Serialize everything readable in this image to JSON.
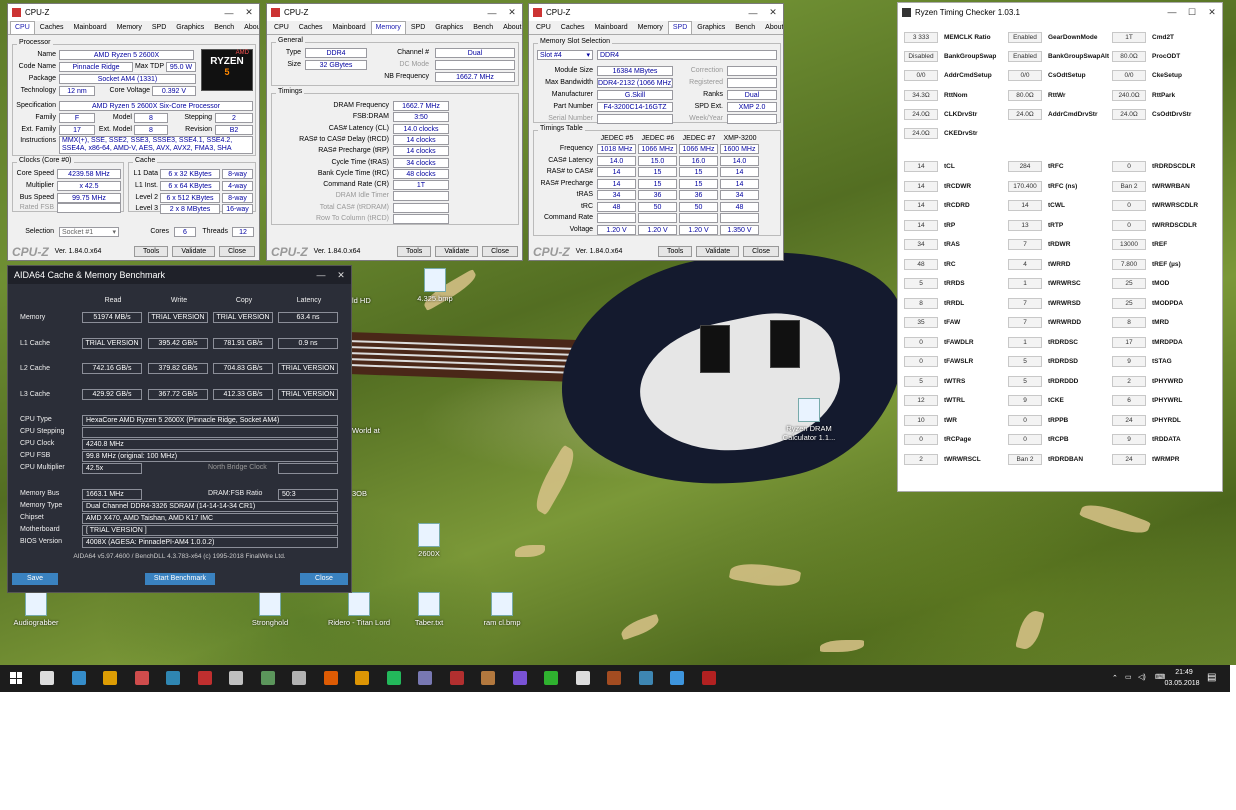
{
  "cpuz1": {
    "title": "CPU-Z",
    "tabs": [
      "CPU",
      "Caches",
      "Mainboard",
      "Memory",
      "SPD",
      "Graphics",
      "Bench",
      "About"
    ],
    "processor_grp": "Processor",
    "name_lbl": "Name",
    "name": "AMD Ryzen 5 2600X",
    "code_lbl": "Code Name",
    "code": "Pinnacle Ridge",
    "tdp_lbl": "Max TDP",
    "tdp": "95.0 W",
    "pkg_lbl": "Package",
    "pkg": "Socket AM4 (1331)",
    "tech_lbl": "Technology",
    "tech": "12 nm",
    "volt_lbl": "Core Voltage",
    "volt": "0.392 V",
    "spec_lbl": "Specification",
    "spec": "AMD Ryzen 5 2600X Six-Core Processor",
    "fam_lbl": "Family",
    "fam": "F",
    "model_lbl": "Model",
    "model": "8",
    "step_lbl": "Stepping",
    "step": "2",
    "efam_lbl": "Ext. Family",
    "efam": "17",
    "emodel_lbl": "Ext. Model",
    "emodel": "8",
    "rev_lbl": "Revision",
    "rev": "B2",
    "instr_lbl": "Instructions",
    "instr": "MMX(+), SSE, SSE2, SSE3, SSSE3, SSE4.1, SSE4.2, SSE4A, x86-64, AMD-V, AES, AVX, AVX2, FMA3, SHA",
    "clocks_grp": "Clocks (Core #0)",
    "cs_lbl": "Core Speed",
    "cs": "4239.58 MHz",
    "mul_lbl": "Multiplier",
    "mul": "x 42.5",
    "bus_lbl": "Bus Speed",
    "bus": "99.75 MHz",
    "fsb_lbl": "Rated FSB",
    "cache_grp": "Cache",
    "l1d_lbl": "L1 Data",
    "l1d": "6 x 32 KBytes",
    "l1d_w": "8-way",
    "l1i_lbl": "L1 Inst.",
    "l1i": "6 x 64 KBytes",
    "l1i_w": "4-way",
    "l2_lbl": "Level 2",
    "l2": "6 x 512 KBytes",
    "l2_w": "8-way",
    "l3_lbl": "Level 3",
    "l3": "2 x 8 MBytes",
    "l3_w": "16-way",
    "sel_lbl": "Selection",
    "sel": "Socket #1",
    "cores_lbl": "Cores",
    "cores": "6",
    "threads_lbl": "Threads",
    "threads": "12",
    "logo_text": "RYZEN",
    "logo_num": "5",
    "footer_logo": "CPU-Z",
    "ver": "Ver. 1.84.0.x64",
    "tools": "Tools",
    "validate": "Validate",
    "close": "Close"
  },
  "cpuz2": {
    "title": "CPU-Z",
    "general_grp": "General",
    "type_lbl": "Type",
    "type": "DDR4",
    "ch_lbl": "Channel #",
    "ch": "Dual",
    "size_lbl": "Size",
    "size": "32 GBytes",
    "dc_lbl": "DC Mode",
    "nb_lbl": "NB Frequency",
    "nb": "1662.7 MHz",
    "timings_grp": "Timings",
    "t": [
      [
        "DRAM Frequency",
        "1662.7 MHz",
        false
      ],
      [
        "FSB:DRAM",
        "3:50",
        false
      ],
      [
        "CAS# Latency (CL)",
        "14.0 clocks",
        false
      ],
      [
        "RAS# to CAS# Delay (tRCD)",
        "14 clocks",
        false
      ],
      [
        "RAS# Precharge (tRP)",
        "14 clocks",
        false
      ],
      [
        "Cycle Time (tRAS)",
        "34 clocks",
        false
      ],
      [
        "Bank Cycle Time (tRC)",
        "48 clocks",
        false
      ],
      [
        "Command Rate (CR)",
        "1T",
        false
      ],
      [
        "DRAM Idle Timer",
        "",
        true
      ],
      [
        "Total CAS# (tRDRAM)",
        "",
        true
      ],
      [
        "Row To Column (tRCD)",
        "",
        true
      ]
    ]
  },
  "cpuz3": {
    "title": "CPU-Z",
    "slot_grp": "Memory Slot Selection",
    "slot": "Slot #4",
    "slot_type": "DDR4",
    "ms_lbl": "Module Size",
    "ms": "16384 MBytes",
    "corr_lbl": "Correction",
    "bw_lbl": "Max Bandwidth",
    "bw": "DDR4-2132 (1066 MHz)",
    "reg_lbl": "Registered",
    "man_lbl": "Manufacturer",
    "man": "G.Skill",
    "ranks_lbl": "Ranks",
    "ranks": "Dual",
    "pn_lbl": "Part Number",
    "pn": "F4-3200C14-16GTZ",
    "spd_lbl": "SPD Ext.",
    "spd": "XMP 2.0",
    "sn_lbl": "Serial Number",
    "wk_lbl": "Week/Year",
    "tt_grp": "Timings Table",
    "cols": [
      "JEDEC #5",
      "JEDEC #6",
      "JEDEC #7",
      "XMP-3200"
    ],
    "rows": [
      [
        "Frequency",
        "1018 MHz",
        "1066 MHz",
        "1066 MHz",
        "1600 MHz"
      ],
      [
        "CAS# Latency",
        "14.0",
        "15.0",
        "16.0",
        "14.0"
      ],
      [
        "RAS# to CAS#",
        "14",
        "15",
        "15",
        "14"
      ],
      [
        "RAS# Precharge",
        "14",
        "15",
        "15",
        "14"
      ],
      [
        "tRAS",
        "34",
        "36",
        "36",
        "34"
      ],
      [
        "tRC",
        "48",
        "50",
        "50",
        "48"
      ],
      [
        "Command Rate",
        "",
        "",
        "",
        ""
      ],
      [
        "Voltage",
        "1.20 V",
        "1.20 V",
        "1.20 V",
        "1.350 V"
      ]
    ]
  },
  "aida": {
    "title": "AIDA64 Cache & Memory Benchmark",
    "heads": [
      "Read",
      "Write",
      "Copy",
      "Latency"
    ],
    "bench": [
      [
        "Memory",
        "51974 MB/s",
        "TRIAL VERSION",
        "TRIAL VERSION",
        "63.4 ns"
      ],
      [
        "L1 Cache",
        "TRIAL VERSION",
        "395.42 GB/s",
        "781.91 GB/s",
        "0.9 ns"
      ],
      [
        "L2 Cache",
        "742.16 GB/s",
        "379.82 GB/s",
        "704.83 GB/s",
        "TRIAL VERSION"
      ],
      [
        "L3 Cache",
        "429.92 GB/s",
        "367.72 GB/s",
        "412.33 GB/s",
        "TRIAL VERSION"
      ]
    ],
    "info1": [
      [
        "CPU Type",
        "HexaCore AMD Ryzen 5 2600X (Pinnacle Ridge, Socket AM4)"
      ],
      [
        "CPU Stepping",
        ""
      ],
      [
        "CPU Clock",
        "4240.8 MHz"
      ],
      [
        "CPU FSB",
        "99.8 MHz (original: 100 MHz)"
      ]
    ],
    "mult_lbl": "CPU Multiplier",
    "mult": "42.5x",
    "nbclk_lbl": "North Bridge Clock",
    "membus_lbl": "Memory Bus",
    "membus": "1663.1 MHz",
    "ratio_lbl": "DRAM:FSB Ratio",
    "ratio": "50:3",
    "info2": [
      [
        "Memory Type",
        "Dual Channel DDR4-3326 SDRAM (14-14-14-34 CR1)"
      ],
      [
        "Chipset",
        "AMD X470, AMD Taishan, AMD K17 IMC"
      ],
      [
        "Motherboard",
        "[ TRIAL VERSION ]"
      ],
      [
        "BIOS Version",
        "4008X (AGESA: PinnaclePI-AM4 1.0.0.2)"
      ]
    ],
    "copyright": "AIDA64 v5.97.4600 / BenchDLL 4.3.783-x64 (c) 1995-2018 FinalWire Ltd.",
    "save": "Save",
    "start": "Start Benchmark",
    "close": "Close"
  },
  "rtc": {
    "title": "Ryzen Timing Checker 1.03.1",
    "top": [
      [
        "3 333",
        "MEMCLK Ratio",
        "Enabled",
        "GearDownMode",
        "1T",
        "Cmd2T"
      ],
      [
        "Disabled",
        "BankGroupSwap",
        "Enabled",
        "BankGroupSwapAlt",
        "80.0Ω",
        "ProcODT"
      ],
      [
        "0/0",
        "AddrCmdSetup",
        "0/0",
        "CsOdtSetup",
        "0/0",
        "CkeSetup"
      ],
      [
        "34.3Ω",
        "RttNom",
        "80.0Ω",
        "RttWr",
        "240.0Ω",
        "RttPark"
      ],
      [
        "24.0Ω",
        "CLKDrvStr",
        "24.0Ω",
        "AddrCmdDrvStr",
        "24.0Ω",
        "CsOdtDrvStr"
      ],
      [
        "24.0Ω",
        "CKEDrvStr",
        "",
        "",
        "",
        ""
      ]
    ],
    "timings": [
      [
        "14",
        "tCL",
        "284",
        "tRFC",
        "0",
        "tRDRDSCDLR"
      ],
      [
        "14",
        "tRCDWR",
        "170.400",
        "tRFC (ns)",
        "Ban 2",
        "tWRWRBAN"
      ],
      [
        "14",
        "tRCDRD",
        "14",
        "tCWL",
        "0",
        "tWRWRSCDLR"
      ],
      [
        "14",
        "tRP",
        "13",
        "tRTP",
        "0",
        "tWRRDSCDLR"
      ],
      [
        "34",
        "tRAS",
        "7",
        "tRDWR",
        "13000",
        "tREF"
      ],
      [
        "48",
        "tRC",
        "4",
        "tWRRD",
        "7.800",
        "tREF (µs)"
      ],
      [
        "5",
        "tRRDS",
        "1",
        "tWRWRSC",
        "25",
        "tMOD"
      ],
      [
        "8",
        "tRRDL",
        "7",
        "tWRWRSD",
        "25",
        "tMODPDA"
      ],
      [
        "35",
        "tFAW",
        "7",
        "tWRWRDD",
        "8",
        "tMRD"
      ],
      [
        "0",
        "tFAWDLR",
        "1",
        "tRDRDSC",
        "17",
        "tMRDPDA"
      ],
      [
        "0",
        "tFAWSLR",
        "5",
        "tRDRDSD",
        "9",
        "tSTAG"
      ],
      [
        "5",
        "tWTRS",
        "5",
        "tRDRDDD",
        "2",
        "tPHYWRD"
      ],
      [
        "12",
        "tWTRL",
        "9",
        "tCKE",
        "6",
        "tPHYWRL"
      ],
      [
        "10",
        "tWR",
        "0",
        "tRPPB",
        "24",
        "tPHYRDL"
      ],
      [
        "0",
        "tRCPage",
        "0",
        "tRCPB",
        "9",
        "tRDDATA"
      ],
      [
        "2",
        "tWRWRSCL",
        "Ban 2",
        "tRDRDBAN",
        "24",
        "tWRMPR"
      ]
    ],
    "t_dim": {
      "0": true
    }
  },
  "desktop_icons": [
    [
      "4.325.bmp",
      411,
      268
    ],
    [
      "Ryzen DRAM Calculator 1.1...",
      785,
      398
    ],
    [
      "Audiograbber",
      12,
      592
    ],
    [
      "Stronghold",
      246,
      592
    ],
    [
      "Ridero - Titan Lord",
      335,
      592
    ],
    [
      "Taber.txt",
      405,
      592
    ],
    [
      "ram cl.bmp",
      478,
      592
    ],
    [
      "2600X",
      405,
      523
    ]
  ],
  "desktop_partial": [
    [
      "ld HD",
      352,
      296
    ],
    [
      "World at",
      352,
      426
    ],
    [
      "3OB",
      352,
      489
    ]
  ],
  "tray": {
    "time": "21:49",
    "date": "03.05.2018"
  }
}
